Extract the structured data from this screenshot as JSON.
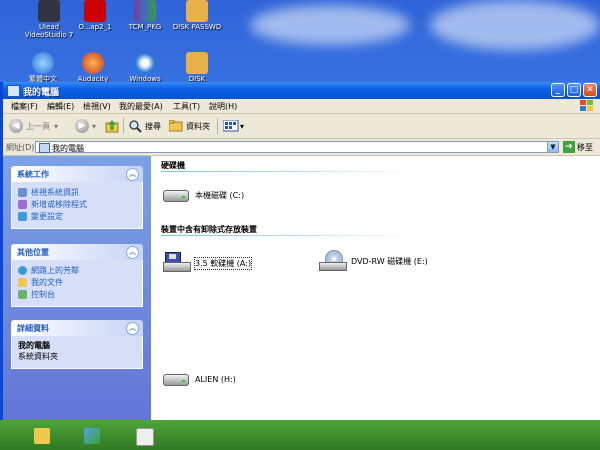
{
  "desktop": {
    "icons_row1": [
      "Ulead VideoStudio 7",
      "O...ap2_1",
      "TCM_PKG",
      "DISK PASSWD"
    ],
    "icons_row2": [
      "繁體中文",
      "Audacity",
      "Windows",
      "DISK"
    ]
  },
  "window": {
    "title": "我的電腦",
    "menu": [
      "檔案(F)",
      "編輯(E)",
      "檢視(V)",
      "我的最愛(A)",
      "工具(T)",
      "說明(H)"
    ],
    "toolbar": {
      "back": "上一頁",
      "search": "搜尋",
      "folders": "資料夾"
    },
    "address": {
      "label": "網址(D)",
      "value": "我的電腦",
      "go": "移至"
    }
  },
  "taskpane": {
    "system_tasks": {
      "title": "系統工作",
      "items": [
        "檢視系統資訊",
        "新增或移除程式",
        "變更設定"
      ]
    },
    "other_places": {
      "title": "其他位置",
      "items": [
        "網路上的芳鄰",
        "我的文件",
        "控制台"
      ]
    },
    "details": {
      "title": "詳細資料",
      "name": "我的電腦",
      "subtitle": "系統資料夾"
    }
  },
  "content": {
    "hard_disks_title": "硬碟機",
    "removable_title": "裝置中含有卸除式存放裝置",
    "drives": {
      "local_c": "本機磁碟 (C:)",
      "floppy_a": "3.5 軟碟機 (A:)",
      "dvd_e": "DVD-RW 磁碟機 (E:)",
      "alien_h": "ALIEN (H:)"
    }
  },
  "colors": {
    "xp_blue": "#0a5fe8",
    "taskpane_link": "#215dc6"
  }
}
